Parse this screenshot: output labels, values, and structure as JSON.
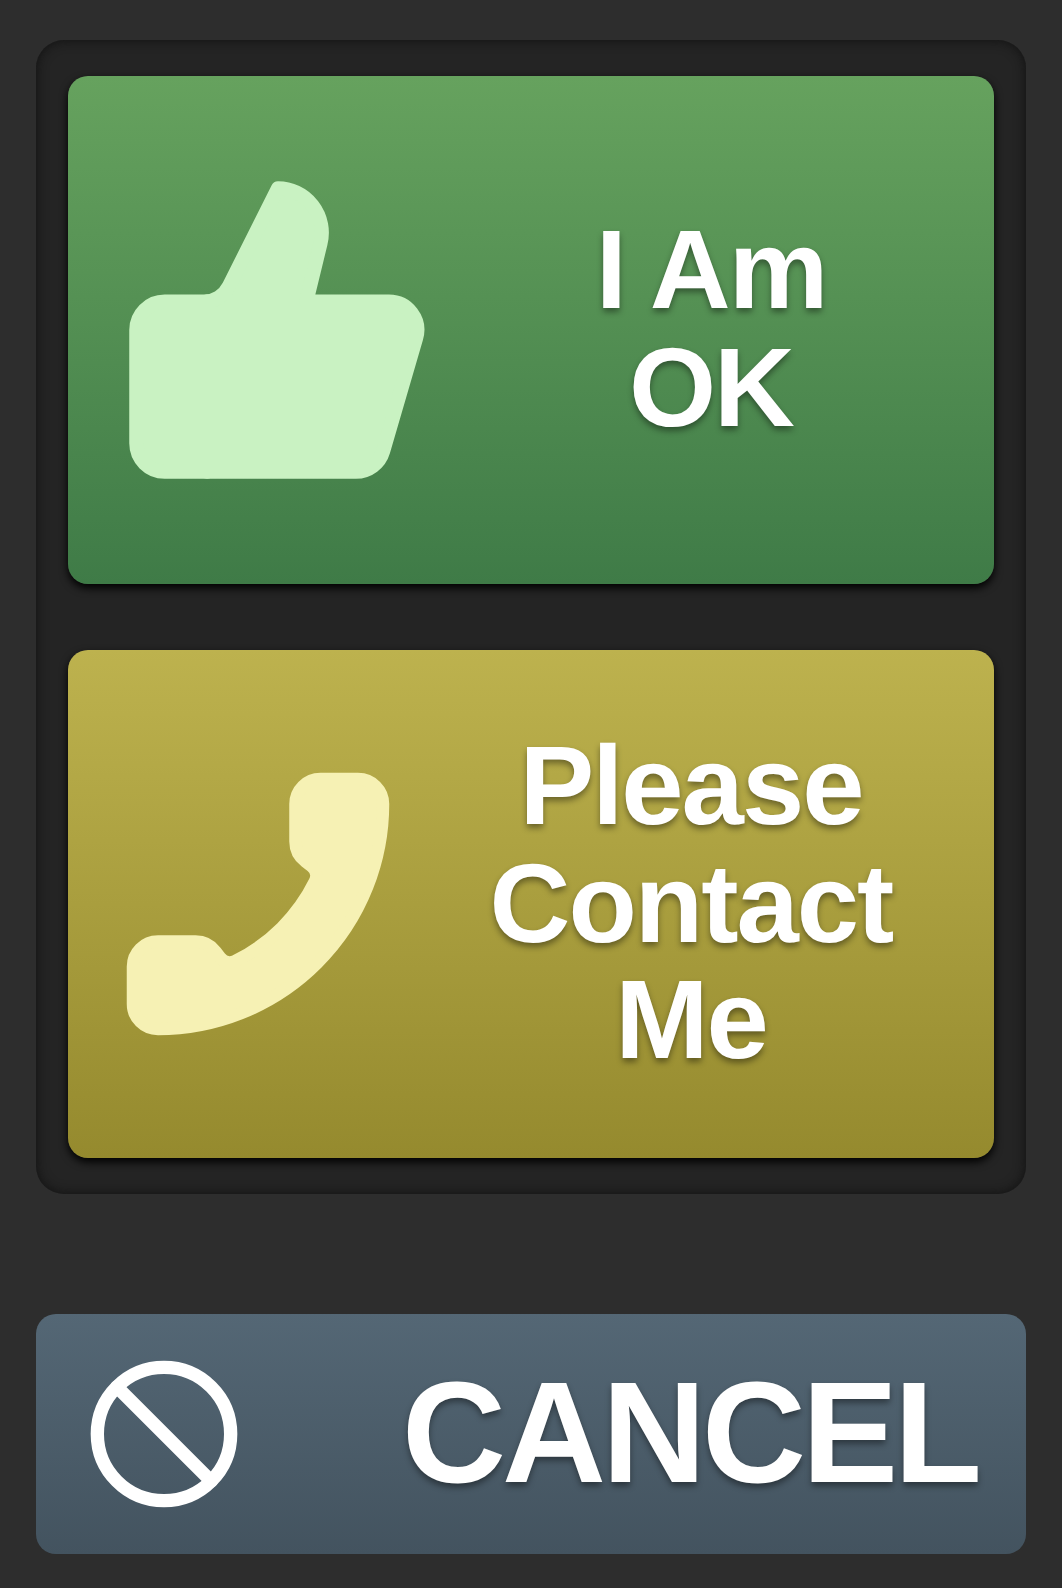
{
  "actions": [
    {
      "kind": "ok",
      "label": "I Am\nOK"
    },
    {
      "kind": "contact",
      "label": "Please\nContact\nMe"
    }
  ],
  "cancel": {
    "label": "CANCEL"
  }
}
